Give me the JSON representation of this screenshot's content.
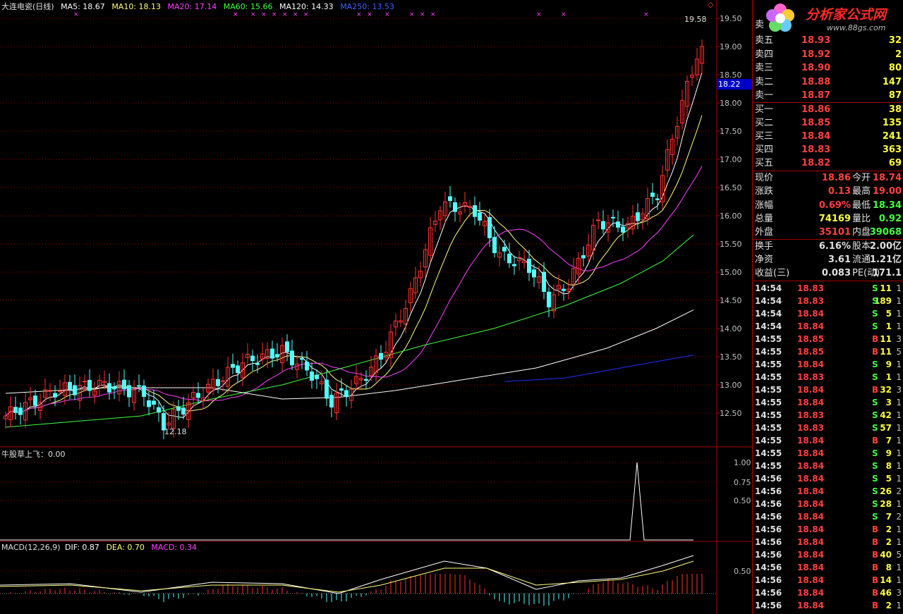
{
  "main_legend": {
    "title": "大连电瓷(日线)",
    "items": [
      {
        "label": "MA5: 18.67",
        "color": "#ffffff"
      },
      {
        "label": "MA10: 18.13",
        "color": "#ffff80"
      },
      {
        "label": "MA20: 17.14",
        "color": "#ff40ff"
      },
      {
        "label": "MA60: 15.66",
        "color": "#40ff40"
      },
      {
        "label": "MA120: 14.33",
        "color": "#ffffff"
      },
      {
        "label": "MA250: 13.53",
        "color": "#4040ff"
      }
    ]
  },
  "price_axis_ticks": [
    "19.50",
    "19.00",
    "18.50",
    "18.00",
    "17.50",
    "17.00",
    "16.50",
    "16.00",
    "15.50",
    "15.00",
    "14.50",
    "14.00",
    "13.50",
    "13.00",
    "12.50"
  ],
  "current_price_marker": "18.22",
  "high_annotation": "19.58",
  "low_annotation": "12.18",
  "indicator_legend": "牛股草上飞：0.00",
  "indicator_ticks": [
    "1.00",
    "0.75",
    "0.50"
  ],
  "macd_legend": {
    "name": "MACD(12,26,9)",
    "dif": "DIF: 0.87",
    "dea": "DEA: 0.70",
    "macd": "MACD: 0.34"
  },
  "macd_ticks": [
    "0.50"
  ],
  "logo": {
    "text": "分析家公式网",
    "url": "www.88gs.com"
  },
  "order_book": {
    "partial_top": "卖",
    "asks": [
      {
        "label": "卖五",
        "price": "18.93",
        "volume": "32"
      },
      {
        "label": "卖四",
        "price": "18.92",
        "volume": "2"
      },
      {
        "label": "卖三",
        "price": "18.90",
        "volume": "80"
      },
      {
        "label": "卖二",
        "price": "18.88",
        "volume": "147"
      },
      {
        "label": "卖一",
        "price": "18.87",
        "volume": "87"
      }
    ],
    "bids": [
      {
        "label": "买一",
        "price": "18.86",
        "volume": "38"
      },
      {
        "label": "买二",
        "price": "18.85",
        "volume": "135"
      },
      {
        "label": "买三",
        "price": "18.84",
        "volume": "241"
      },
      {
        "label": "买四",
        "price": "18.83",
        "volume": "363"
      },
      {
        "label": "买五",
        "price": "18.82",
        "volume": "69"
      }
    ]
  },
  "quote": [
    {
      "l1": "现价",
      "v1": "18.86",
      "c1": "#ff4040",
      "l2": "今开",
      "v2": "18.74",
      "c2": "#ff4040"
    },
    {
      "l1": "涨跌",
      "v1": "0.13",
      "c1": "#ff4040",
      "l2": "最高",
      "v2": "19.00",
      "c2": "#ff4040"
    },
    {
      "l1": "涨幅",
      "v1": "0.69%",
      "c1": "#ff4040",
      "l2": "最低",
      "v2": "18.34",
      "c2": "#40ff40"
    },
    {
      "l1": "总量",
      "v1": "74169",
      "c1": "#ffff40",
      "l2": "量比",
      "v2": "0.92",
      "c2": "#40ff40"
    },
    {
      "l1": "外盘",
      "v1": "35101",
      "c1": "#ff4040",
      "l2": "内盘",
      "v2": "39068",
      "c2": "#40ff40"
    }
  ],
  "fundamentals": [
    {
      "l1": "换手",
      "v1": "6.16%",
      "c1": "#e0e0e0",
      "l2": "股本",
      "v2": "2.00亿",
      "c2": "#e0e0e0"
    },
    {
      "l1": "净资",
      "v1": "3.61",
      "c1": "#e0e0e0",
      "l2": "流通",
      "v2": "1.21亿",
      "c2": "#e0e0e0"
    },
    {
      "l1": "收益(三)",
      "v1": "0.083",
      "c1": "#e0e0e0",
      "l2": "PE(动)",
      "v2": "171.1",
      "c2": "#e0e0e0"
    }
  ],
  "ticks": [
    {
      "time": "14:54",
      "price": "18.83",
      "vol": "11",
      "side": "S",
      "count": "1"
    },
    {
      "time": "14:54",
      "price": "18.83",
      "vol": "189",
      "side": "S",
      "count": "1"
    },
    {
      "time": "14:54",
      "price": "18.84",
      "vol": "5",
      "side": "S",
      "count": "1"
    },
    {
      "time": "14:54",
      "price": "18.84",
      "vol": "1",
      "side": "S",
      "count": "1"
    },
    {
      "time": "14:55",
      "price": "18.85",
      "vol": "11",
      "side": "B",
      "count": "3"
    },
    {
      "time": "14:55",
      "price": "18.85",
      "vol": "11",
      "side": "B",
      "count": "5"
    },
    {
      "time": "14:55",
      "price": "18.84",
      "vol": "9",
      "side": "S",
      "count": "1"
    },
    {
      "time": "14:55",
      "price": "18.83",
      "vol": "1",
      "side": "S",
      "count": "1"
    },
    {
      "time": "14:55",
      "price": "18.84",
      "vol": "32",
      "side": "B",
      "count": "3"
    },
    {
      "time": "14:55",
      "price": "18.84",
      "vol": "3",
      "side": "S",
      "count": "1"
    },
    {
      "time": "14:55",
      "price": "18.83",
      "vol": "42",
      "side": "S",
      "count": "1"
    },
    {
      "time": "14:55",
      "price": "18.83",
      "vol": "57",
      "side": "S",
      "count": "1"
    },
    {
      "time": "14:55",
      "price": "18.84",
      "vol": "7",
      "side": "B",
      "count": "1"
    },
    {
      "time": "14:55",
      "price": "18.84",
      "vol": "9",
      "side": "S",
      "count": "1"
    },
    {
      "time": "14:55",
      "price": "18.84",
      "vol": "8",
      "side": "S",
      "count": "1"
    },
    {
      "time": "14:56",
      "price": "18.84",
      "vol": "5",
      "side": "S",
      "count": "1"
    },
    {
      "time": "14:56",
      "price": "18.84",
      "vol": "26",
      "side": "S",
      "count": "2"
    },
    {
      "time": "14:56",
      "price": "18.84",
      "vol": "28",
      "side": "S",
      "count": "1"
    },
    {
      "time": "14:56",
      "price": "18.84",
      "vol": "7",
      "side": "S",
      "count": "2"
    },
    {
      "time": "14:56",
      "price": "18.84",
      "vol": "2",
      "side": "B",
      "count": "1"
    },
    {
      "time": "14:56",
      "price": "18.84",
      "vol": "2",
      "side": "B",
      "count": "1"
    },
    {
      "time": "14:56",
      "price": "18.84",
      "vol": "40",
      "side": "B",
      "count": "5"
    },
    {
      "time": "14:56",
      "price": "18.84",
      "vol": "8",
      "side": "B",
      "count": "1"
    },
    {
      "time": "14:56",
      "price": "18.84",
      "vol": "14",
      "side": "B",
      "count": "1"
    },
    {
      "time": "14:56",
      "price": "18.84",
      "vol": "46",
      "side": "B",
      "count": "3"
    },
    {
      "time": "14:56",
      "price": "18.84",
      "vol": "2",
      "side": "B",
      "count": "1"
    }
  ],
  "colors": {
    "up": "#ff3030",
    "down": "#54ffff",
    "grid": "#a00000",
    "buy": "#ff4040",
    "sell": "#40ff40"
  }
}
